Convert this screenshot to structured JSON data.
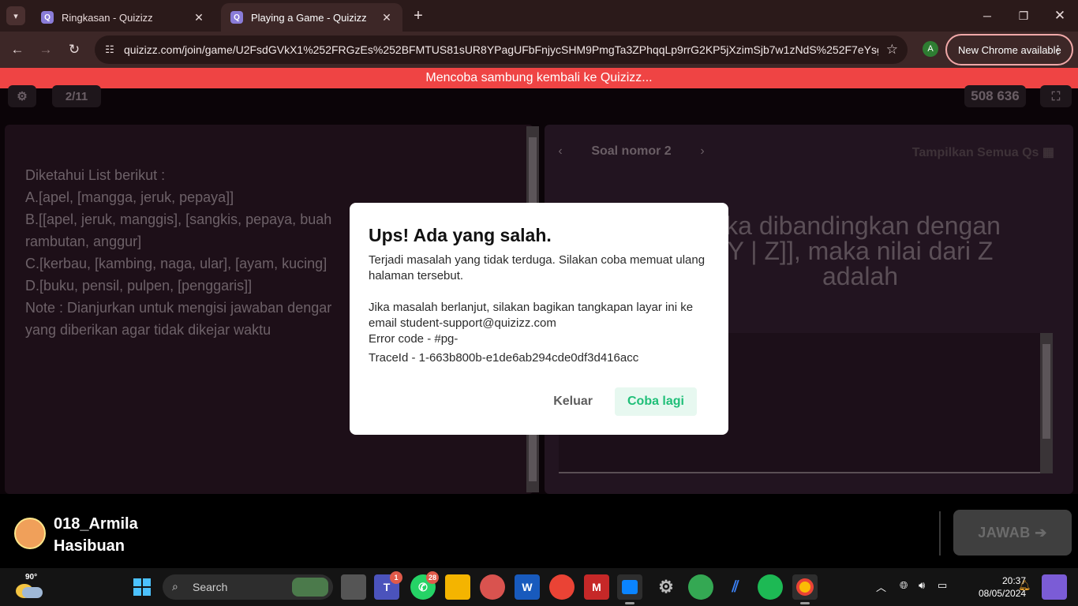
{
  "browser": {
    "tabs": [
      {
        "label": "Ringkasan - Quizizz",
        "favicon": "Q"
      },
      {
        "label": "Playing a Game - Quizizz",
        "favicon": "Q"
      }
    ],
    "url": "quizizz.com/join/game/U2FsdGVkX1%252FRGzEs%252BFMTUS81sUR8YPagUFbFnjycSHM9PmgTa3ZPhqqLp9rrG2KP5jXzimSjb7w1zNdS%252F7eYsg%253...",
    "profile_initial": "A",
    "update_button": "New Chrome available"
  },
  "banner": {
    "text": "Mencoba sambung kembali ke Quizizz..."
  },
  "quiz": {
    "progress": "2/11",
    "score": "508 636",
    "question_lines": [
      "Diketahui List berikut :",
      "A.[apel, [mangga, jeruk, pepaya]]",
      "B.[[apel, jeruk, manggis], [sangkis, pepaya, buah",
      "rambutan, anggur]",
      "C.[kerbau, [kambing, naga, ular], [ayam, kucing]",
      "D.[buku, pensil, pulpen, [penggaris]]",
      "Note : Dianjurkan untuk mengisi jawaban dengar",
      "yang diberikan agar tidak dikejar waktu"
    ],
    "soal_label": "Soal nomor 2",
    "show_all": "Tampilkan Semua Qs",
    "question_big_lines": [
      "ika dibandingkan dengan",
      "Y | Z]], maka nilai dari Z",
      "adalah"
    ],
    "player_name_line1": "018_Armila",
    "player_name_line2": "Hasibuan",
    "answer_button": "JAWAB"
  },
  "modal": {
    "title": "Ups! Ada yang salah.",
    "body1": "Terjadi masalah yang tidak terduga. Silakan coba memuat ulang halaman tersebut.",
    "body2": "Jika masalah berlanjut, silakan bagikan tangkapan layar ini ke email student-support@quizizz.com",
    "error_code": "Error code - #pg-",
    "trace": "TraceId - 1-663b800b-e1de6ab294cde0df3d416acc",
    "cancel": "Keluar",
    "retry": "Coba lagi"
  },
  "taskbar": {
    "weather_temp": "90°",
    "search_label": "Search",
    "teams_badge": "1",
    "whatsapp_badge": "28",
    "time": "20:37",
    "date": "08/05/2024"
  }
}
